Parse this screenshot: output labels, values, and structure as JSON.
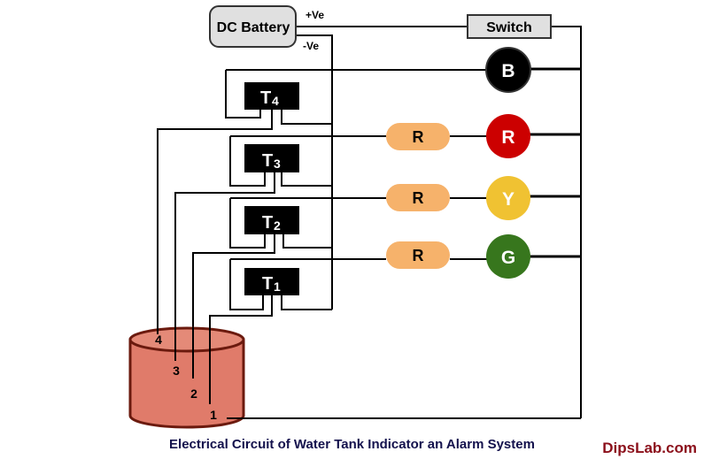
{
  "diagram": {
    "title": "Electrical Circuit of Water Tank Indicator an Alarm System",
    "credit": "DipsLab.com",
    "battery": {
      "label": "DC Battery",
      "positive": "+Ve",
      "negative": "-Ve"
    },
    "switch": {
      "label": "Switch"
    },
    "transistors": [
      {
        "main": "T",
        "sub": "4"
      },
      {
        "main": "T",
        "sub": "3"
      },
      {
        "main": "T",
        "sub": "2"
      },
      {
        "main": "T",
        "sub": "1"
      }
    ],
    "resistors": [
      {
        "label": "R"
      },
      {
        "label": "R"
      },
      {
        "label": "R"
      }
    ],
    "indicators": [
      {
        "label": "B",
        "meaning": "Buzzer",
        "color": "#000000"
      },
      {
        "label": "R",
        "meaning": "Red LED",
        "color": "#cc0000"
      },
      {
        "label": "Y",
        "meaning": "Yellow LED",
        "color": "#f0c232"
      },
      {
        "label": "G",
        "meaning": "Green LED",
        "color": "#37761d"
      }
    ],
    "tank": {
      "fill": "#e07b6a",
      "outline": "#6b1a0e",
      "probes": [
        "4",
        "3",
        "2",
        "1"
      ]
    },
    "colors": {
      "resistor_fill": "#f6b26b",
      "battery_fill": "#e0e0e0",
      "switch_fill": "#e0e0e0"
    }
  }
}
